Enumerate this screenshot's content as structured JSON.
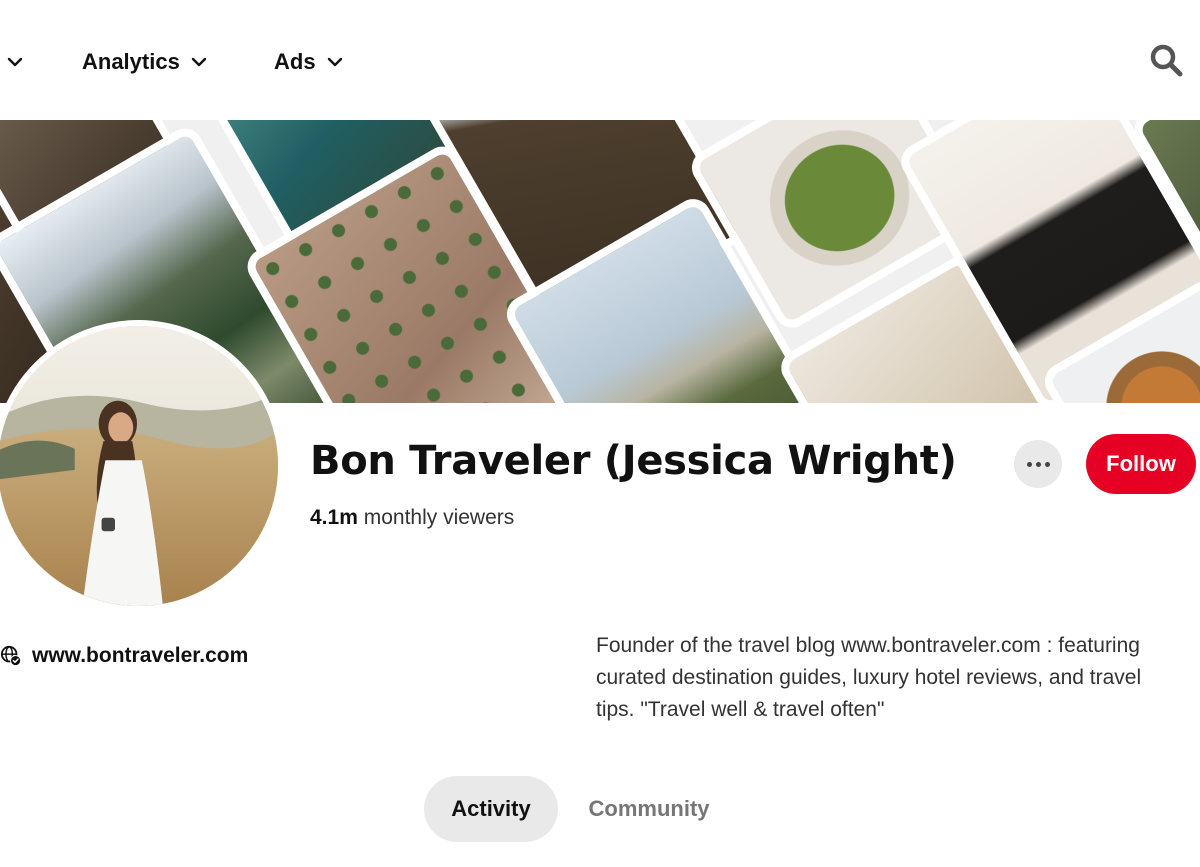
{
  "nav": {
    "items": [
      {
        "label": ""
      },
      {
        "label": "Analytics"
      },
      {
        "label": "Ads"
      }
    ],
    "icons": {
      "search": "search-icon",
      "chevron": "chevron-down-icon"
    }
  },
  "profile": {
    "name": "Bon Traveler (Jessica Wright)",
    "viewers_count": "4.1m",
    "viewers_label": "monthly viewers",
    "website": "www.bontraveler.com",
    "bio": "Founder of the travel blog www.bontraveler.com : featuring curated destination guides, luxury hotel reviews, and travel tips. \"Travel well & travel often\"",
    "follow_label": "Follow"
  },
  "tabs": [
    {
      "label": "Activity",
      "selected": true
    },
    {
      "label": "Community",
      "selected": false
    }
  ],
  "colors": {
    "accent": "#e60023",
    "tab_selected_bg": "#e9e9e9",
    "text_primary": "#111111",
    "text_muted": "#767676"
  }
}
